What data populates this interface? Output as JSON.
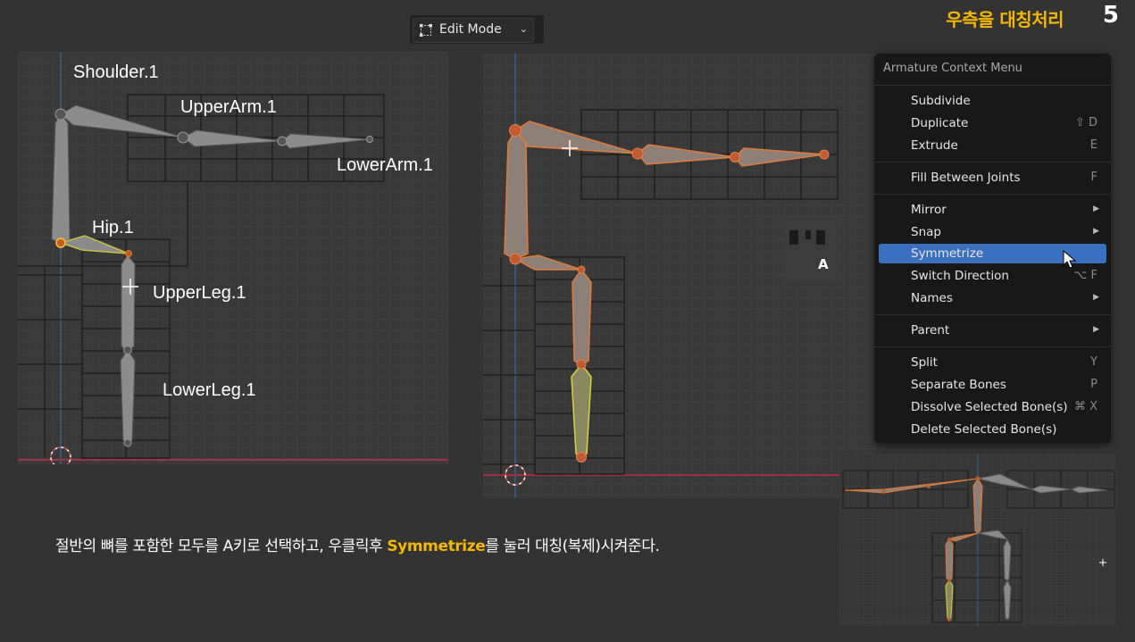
{
  "header": {
    "title": "우측을 대칭처리",
    "page_number": "5"
  },
  "toolbar": {
    "mode_label": "Edit Mode",
    "mode_icon": "edit-mode-icon"
  },
  "left_viewport": {
    "labels": {
      "shoulder": "Shoulder.1",
      "upper_arm": "UpperArm.1",
      "lower_arm": "LowerArm.1",
      "hip": "Hip.1",
      "upper_leg": "UpperLeg.1",
      "lower_leg": "LowerLeg.1"
    }
  },
  "middle_viewport": {
    "key_hint": "A"
  },
  "context_menu": {
    "title": "Armature Context Menu",
    "items": [
      {
        "label": "Subdivide",
        "shortcut": ""
      },
      {
        "label": "Duplicate",
        "shortcut": "⇧ D"
      },
      {
        "label": "Extrude",
        "shortcut": "E"
      },
      {
        "label": "Fill Between Joints",
        "shortcut": "F"
      },
      {
        "label": "Mirror",
        "submenu": true
      },
      {
        "label": "Snap",
        "submenu": true
      },
      {
        "label": "Symmetrize",
        "active": true
      },
      {
        "label": "Switch Direction",
        "shortcut": "⌥ F"
      },
      {
        "label": "Names",
        "submenu": true
      },
      {
        "label": "Parent",
        "submenu": true
      },
      {
        "label": "Split",
        "shortcut": "Y"
      },
      {
        "label": "Separate Bones",
        "shortcut": "P"
      },
      {
        "label": "Dissolve Selected Bone(s)",
        "shortcut": "⌘ X"
      },
      {
        "label": "Delete Selected Bone(s)",
        "shortcut": ""
      }
    ]
  },
  "caption": {
    "before": "절반의 뼈를 포함한 모두를 A키로 선택하고,  우클릭후 ",
    "highlight": "Symmetrize",
    "after": "를 눌러 대칭(복제)시켜준다."
  },
  "colors": {
    "accent": "#f5b800",
    "menu_highlight": "#3b6fc0",
    "bone_selected": "#e07b39",
    "bone_active": "#d8d040"
  }
}
